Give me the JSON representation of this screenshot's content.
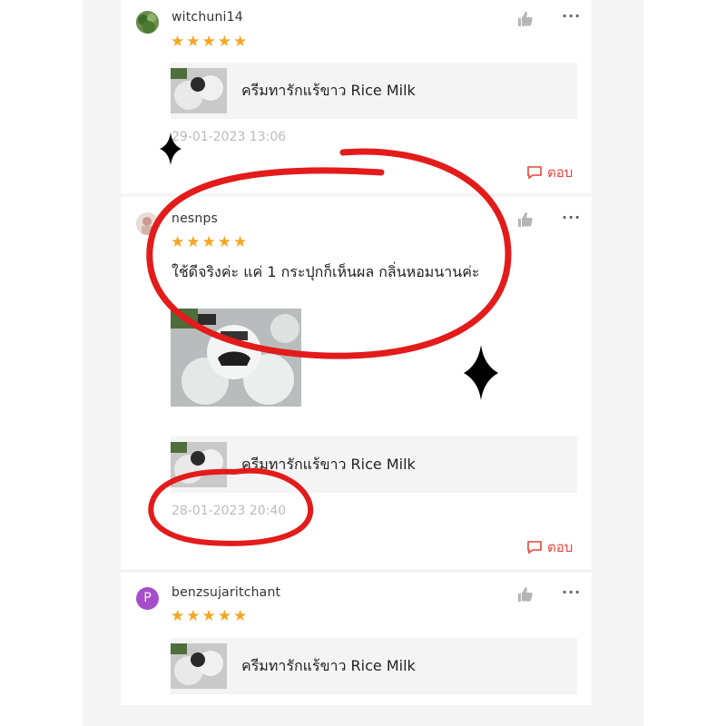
{
  "reviews": [
    {
      "username": "witchuni14",
      "stars": "★★★★★",
      "rating": 5,
      "product_name": "ครีมทารักแร้ขาว Rice Milk",
      "date": "29-01-2023 13:06",
      "reply_label": "ตอบ",
      "avatar_icon": "leaf-avatar-icon"
    },
    {
      "username": "nesnps",
      "stars": "★★★★★",
      "rating": 5,
      "review_text": "ใช้ดีจริงค่ะ แค่ 1 กระปุกก็เห็นผล กลิ่นหอมนานค่ะ",
      "product_name": "ครีมทารักแร้ขาว Rice Milk",
      "date": "28-01-2023 20:40",
      "reply_label": "ตอบ",
      "avatar_icon": "photo-avatar-icon"
    },
    {
      "username": "benzsujaritchant",
      "avatar_letter": "P",
      "stars": "★★★★★",
      "rating": 5,
      "product_name": "ครีมทารักแร้ขาว Rice Milk"
    }
  ],
  "icons": {
    "like": "thumbs-up-icon",
    "more": "more-options-icon",
    "reply": "comment-icon"
  },
  "colors": {
    "accent": "#e8453c",
    "star": "#f5a623",
    "avatar_purple": "#a64dc9",
    "annotation_red": "#e31b1b"
  }
}
